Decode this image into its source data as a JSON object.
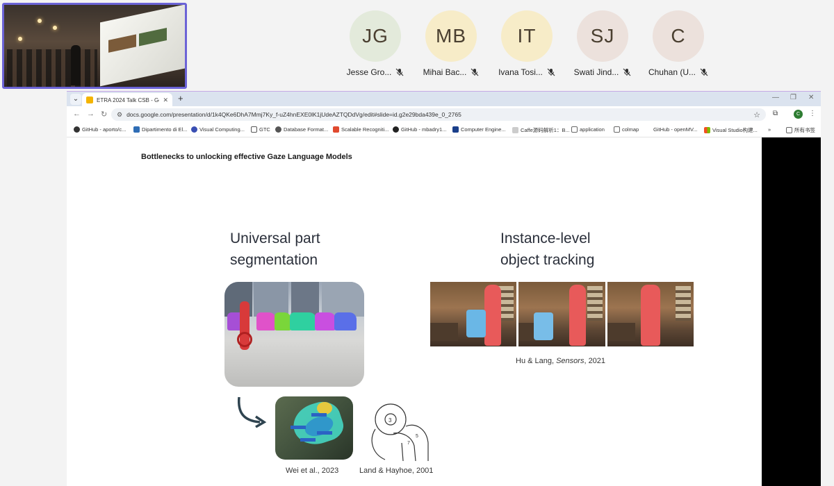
{
  "participants": [
    {
      "initials": "JG",
      "name": "Jesse Gro...",
      "bg": "#e3eadb"
    },
    {
      "initials": "MB",
      "name": "Mihai Bac...",
      "bg": "#f7ecc8"
    },
    {
      "initials": "IT",
      "name": "Ivana Tosi...",
      "bg": "#f7ecc8"
    },
    {
      "initials": "SJ",
      "name": "Swati Jind...",
      "bg": "#ece1dc"
    },
    {
      "initials": "C",
      "name": "Chuhan (U...",
      "bg": "#ece1dc"
    }
  ],
  "browser": {
    "tab_title": "ETRA 2024 Talk CSB - Google",
    "url": "docs.google.com/presentation/d/1k4QKe6DhA7Mmj7Ky_f-uZ4hnEXE0lK1jUdeAZTQDdVg/edit#slide=id.g2e29bda439e_0_2765",
    "profile_initial": "C",
    "bookmarks": [
      {
        "label": "GitHub - aporto/c...",
        "color": "#333333"
      },
      {
        "label": "Dipartimento di El...",
        "color": "#2f6db5"
      },
      {
        "label": "Visual Computing...",
        "color": "#3a4fb3"
      },
      {
        "label": "GTC",
        "color": "#555555"
      },
      {
        "label": "Database Format...",
        "color": "#555555"
      },
      {
        "label": "Scalable Recogniti...",
        "color": "#e04a2f"
      },
      {
        "label": "GitHub - mbadry1...",
        "color": "#222222"
      },
      {
        "label": "Computer Engine...",
        "color": "#1a3f8a"
      },
      {
        "label": "Caffe源码解析1：B...",
        "color": "#cccccc"
      },
      {
        "label": "application",
        "color": "#666666"
      },
      {
        "label": "colmap",
        "color": "#666666"
      },
      {
        "label": "GitHub - openMV...",
        "color": "#ffffff"
      },
      {
        "label": "Visual Studio构建...",
        "color": "#f25022"
      }
    ],
    "more_bookmarks": "»",
    "all_bookmarks": "所有书签"
  },
  "slide": {
    "title": "Bottlenecks to unlocking effective Gaze Language Models",
    "left_heading_1": "Universal part",
    "left_heading_2": "segmentation",
    "right_heading_1": "Instance-level",
    "right_heading_2": "object tracking",
    "caption_wei": "Wei et al., 2023",
    "caption_land": "Land & Hayhoe, 2001",
    "caption_hu_pre": "Hu & Lang, ",
    "caption_hu_journal": "Sensors",
    "caption_hu_post": ", 2021"
  }
}
